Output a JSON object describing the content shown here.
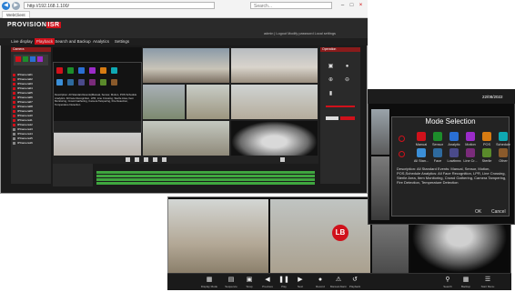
{
  "browser": {
    "url": "http://192.168.1.100/",
    "search_placeholder": "Search...",
    "tab_title": "WebClient"
  },
  "app": {
    "logo_left": "PROVISION",
    "logo_right": "ISR",
    "user_info": "admin | Logout   Modify password   Local settings",
    "menu": [
      "Live display",
      "Playback",
      "Search and Backup",
      "Analytics",
      "Settings"
    ]
  },
  "left_panel": {
    "title": "Camera",
    "channels": [
      "IPCamera01",
      "IPCamera02",
      "IPCamera03",
      "IPCamera04",
      "IPCamera05",
      "IPCamera06",
      "IPCamera07",
      "IPCamera08",
      "IPCamera09",
      "IPCamera10",
      "IPCamera11",
      "IPCamera12",
      "IPCamera13",
      "IPCamera14",
      "IPCamera15",
      "IPCamera16"
    ]
  },
  "overlay": {
    "description": "Description: All Standard Events(Manual, Sensor, Motion, POS Schedule Analytics: All Face Recognition, LPR, Line Crossing, Sterile Area, Item Monitoring, Crowd Gathering, Camera Tampering, Fire Detection, Temperature Detection"
  },
  "right_panel": {
    "title": "Operation"
  },
  "mode_window": {
    "datetime": "22/08/2022",
    "dialog_title": "Mode Selection",
    "row1": [
      "Manual",
      "Sensor",
      "Analytic",
      "Motion",
      "POS",
      "Schedule"
    ],
    "row2": [
      "All Stan...",
      "Face",
      "Lowlinea",
      "Line Cr...",
      "Sterile",
      "Other"
    ],
    "description": "Description: All Standard Events: Manual, Sensor, Motion, POS,Schedule Analytics: All Face Recognition, LPR, Line Crossing, Sterile Area, Item Monitoring, Crowd Gathering, Camera Tampering, Fire Detection, Temperature Detection",
    "ok_label": "OK",
    "cancel_label": "Cancel",
    "colors": [
      "#d0111b",
      "#1d8d2b",
      "#2a6fd4",
      "#9b2bc9",
      "#d67b12",
      "#0fa8b3"
    ]
  },
  "monitor": {
    "taskbar": [
      "Display Mode",
      "Sequence",
      "Snap",
      "Previous",
      "Play",
      "Next",
      "Record",
      "Manual Alarm",
      "Playback",
      "Search",
      "Backup",
      "Start Menu"
    ],
    "badge": "LB"
  }
}
